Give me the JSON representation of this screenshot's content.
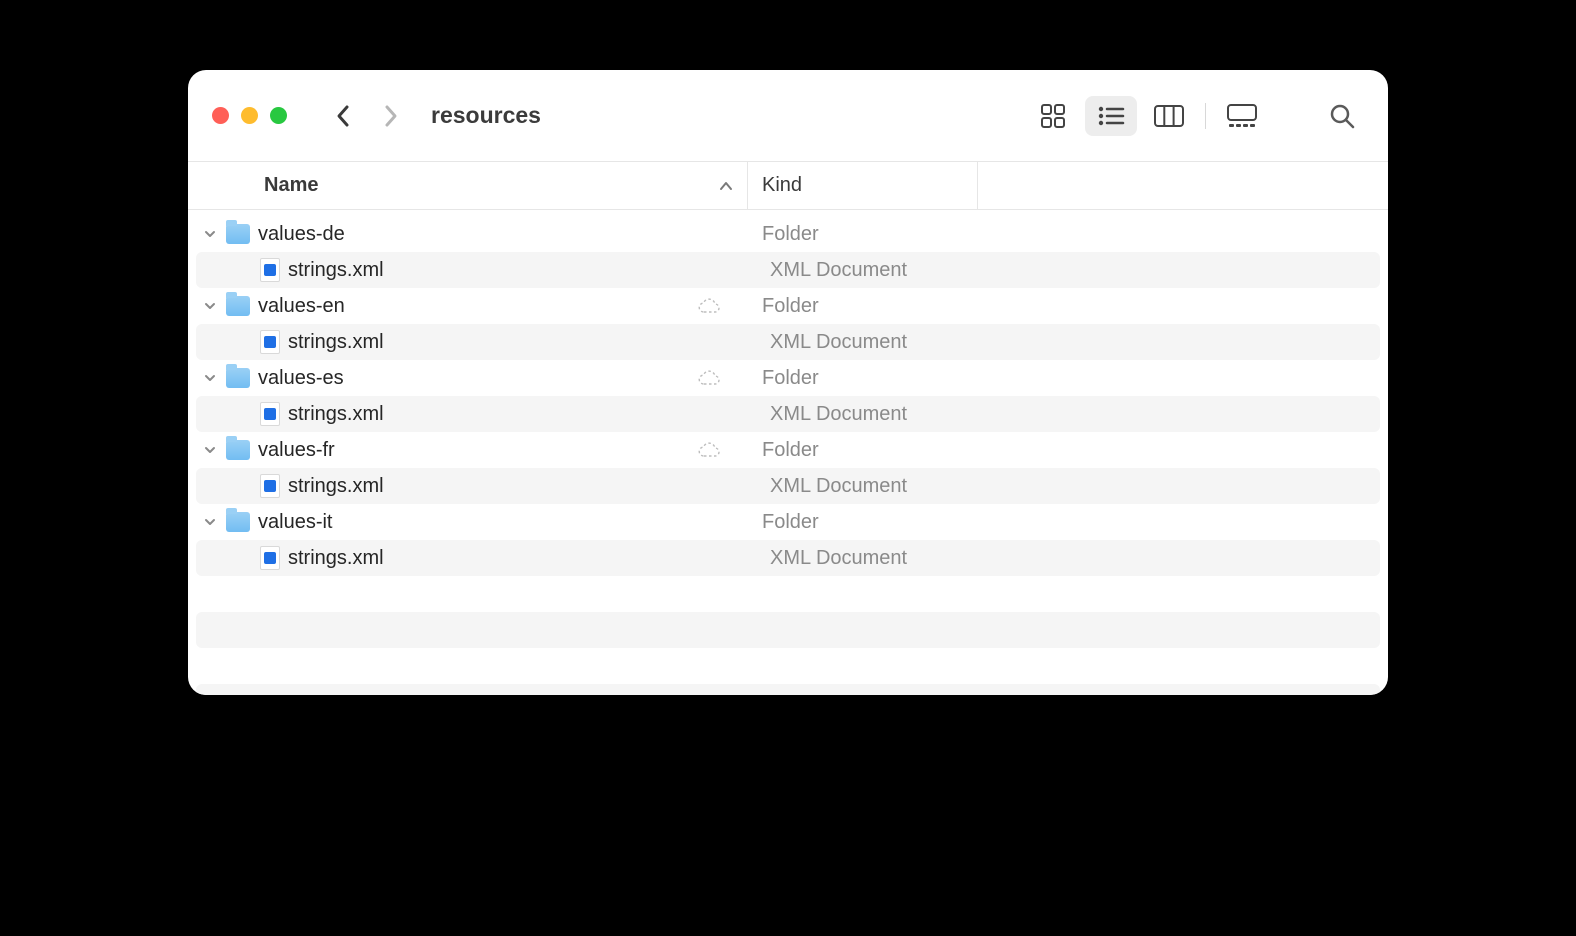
{
  "window": {
    "title": "resources"
  },
  "columns": {
    "name": "Name",
    "kind": "Kind"
  },
  "kinds": {
    "folder": "Folder",
    "xml": "XML Document"
  },
  "rows": [
    {
      "type": "folder",
      "name": "values-de",
      "cloud": false
    },
    {
      "type": "file",
      "name": "strings.xml"
    },
    {
      "type": "folder",
      "name": "values-en",
      "cloud": true
    },
    {
      "type": "file",
      "name": "strings.xml"
    },
    {
      "type": "folder",
      "name": "values-es",
      "cloud": true
    },
    {
      "type": "file",
      "name": "strings.xml"
    },
    {
      "type": "folder",
      "name": "values-fr",
      "cloud": true
    },
    {
      "type": "file",
      "name": "strings.xml"
    },
    {
      "type": "folder",
      "name": "values-it",
      "cloud": false
    },
    {
      "type": "file",
      "name": "strings.xml"
    }
  ]
}
